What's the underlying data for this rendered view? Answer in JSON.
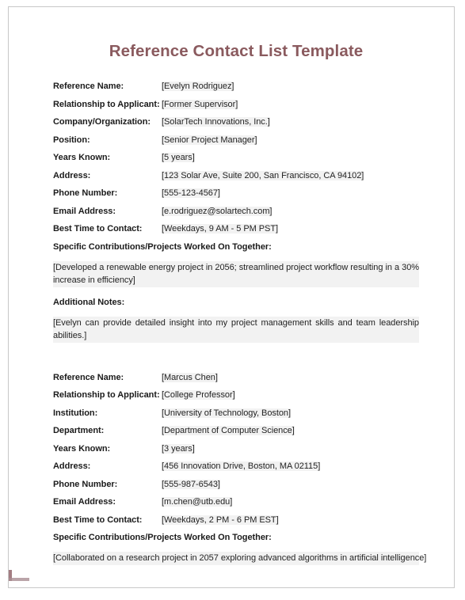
{
  "document": {
    "title": "Reference Contact List Template",
    "title_color": "#8a5a5e",
    "value_highlight_color": "#f2f2f2",
    "page_border_color": "#c8c8c8"
  },
  "references": [
    {
      "fields": [
        {
          "label": "Reference Name:",
          "value": "[Evelyn Rodriguez]"
        },
        {
          "label": "Relationship to Applicant:",
          "value": "[Former Supervisor]"
        },
        {
          "label": "Company/Organization:",
          "value": "[SolarTech Innovations, Inc.]"
        },
        {
          "label": "Position:",
          "value": "[Senior Project Manager]"
        },
        {
          "label": "Years Known:",
          "value": "[5 years]"
        },
        {
          "label": "Address:",
          "value": "[123 Solar Ave, Suite 200, San Francisco, CA 94102]"
        },
        {
          "label": "Phone Number:",
          "value": "[555-123-4567]"
        },
        {
          "label": "Email Address:",
          "value": "[e.rodriguez@solartech.com]"
        },
        {
          "label": "Best Time to Contact:",
          "value": "[Weekdays, 9 AM - 5 PM PST]"
        }
      ],
      "contributions_heading": "Specific Contributions/Projects Worked On Together:",
      "contributions_text": "[Developed a renewable energy project in 2056; streamlined project workflow resulting in a 30% increase in efficiency]",
      "notes_heading": "Additional Notes:",
      "notes_text": "[Evelyn can provide detailed insight into my project management skills and team leadership abilities.]"
    },
    {
      "fields": [
        {
          "label": "Reference Name:",
          "value": "[Marcus Chen]"
        },
        {
          "label": "Relationship to Applicant:",
          "value": "[College Professor]"
        },
        {
          "label": "Institution:",
          "value": "[University of Technology, Boston]"
        },
        {
          "label": "Department:",
          "value": "[Department of Computer Science]"
        },
        {
          "label": "Years Known:",
          "value": "[3 years]"
        },
        {
          "label": "Address:",
          "value": "[456 Innovation Drive, Boston, MA 02115]"
        },
        {
          "label": "Phone Number:",
          "value": "[555-987-6543]"
        },
        {
          "label": "Email Address:",
          "value": "[m.chen@utb.edu]"
        },
        {
          "label": "Best Time to Contact:",
          "value": "[Weekdays, 2 PM - 6 PM EST]"
        }
      ],
      "contributions_heading": "Specific Contributions/Projects Worked On Together:",
      "contributions_text": "[Collaborated on a research project in 2057 exploring advanced algorithms in artificial intelligence]"
    }
  ]
}
